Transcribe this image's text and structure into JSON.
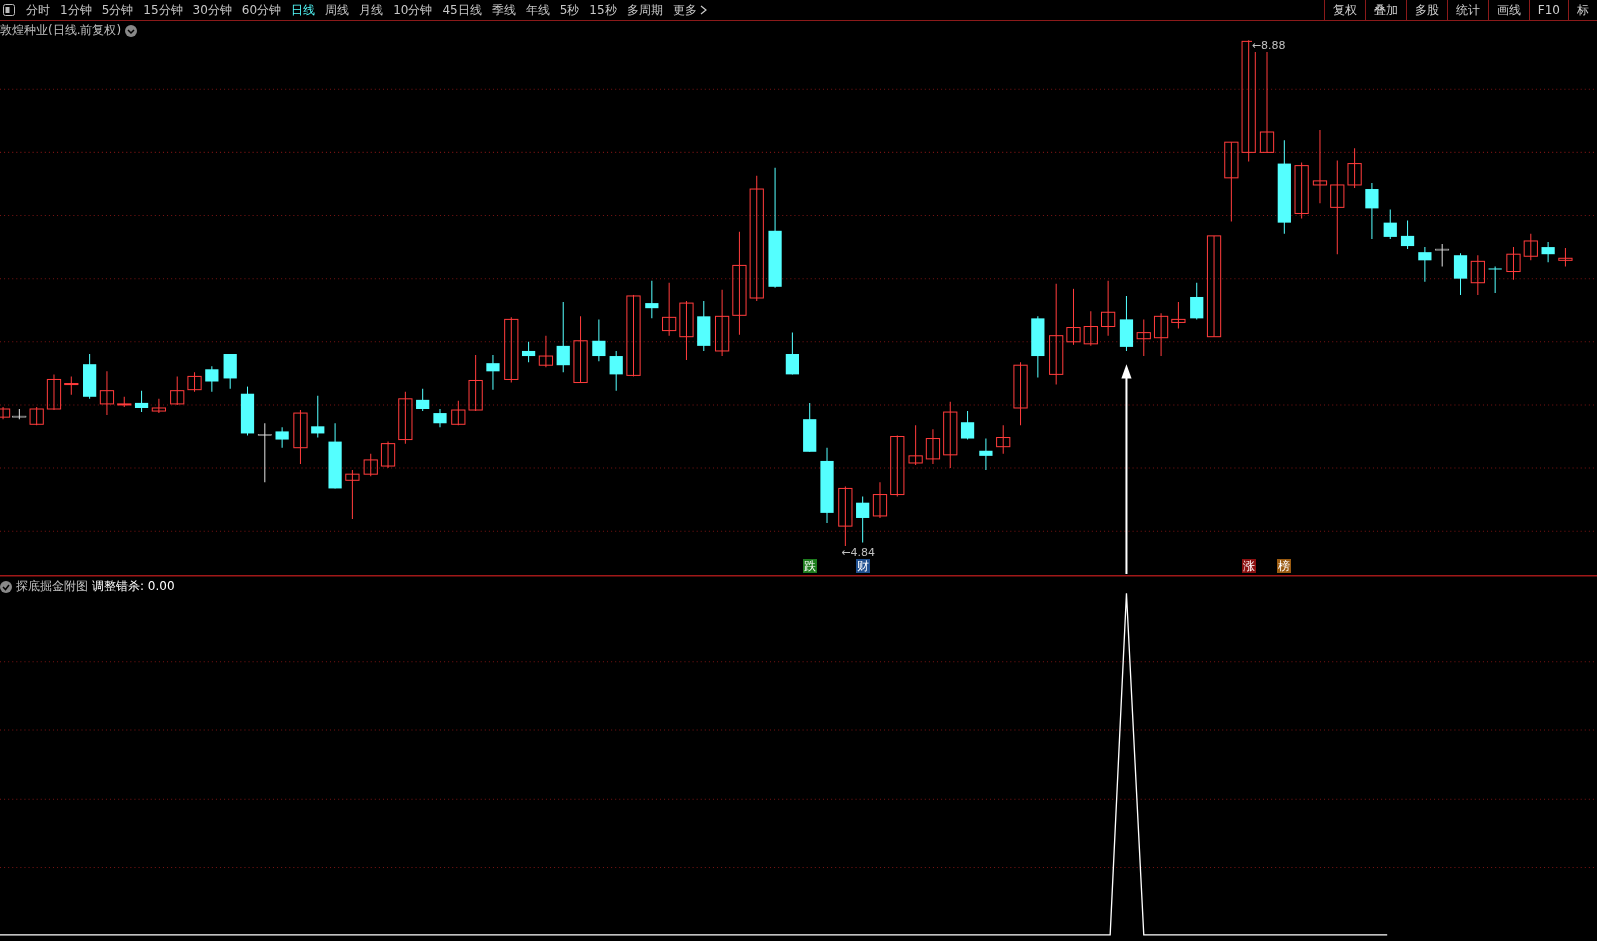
{
  "toolbar": {
    "periods": [
      {
        "label": "分时",
        "selected": false
      },
      {
        "label": "1分钟",
        "selected": false
      },
      {
        "label": "5分钟",
        "selected": false
      },
      {
        "label": "15分钟",
        "selected": false
      },
      {
        "label": "30分钟",
        "selected": false
      },
      {
        "label": "60分钟",
        "selected": false
      },
      {
        "label": "日线",
        "selected": true
      },
      {
        "label": "周线",
        "selected": false
      },
      {
        "label": "月线",
        "selected": false
      },
      {
        "label": "10分钟",
        "selected": false
      },
      {
        "label": "45日线",
        "selected": false
      },
      {
        "label": "季线",
        "selected": false
      },
      {
        "label": "年线",
        "selected": false
      },
      {
        "label": "5秒",
        "selected": false
      },
      {
        "label": "15秒",
        "selected": false
      },
      {
        "label": "多周期",
        "selected": false
      }
    ],
    "more": "更多",
    "tools": [
      "复权",
      "叠加",
      "多股",
      "统计",
      "画线",
      "F10",
      "标"
    ]
  },
  "main_chart": {
    "title": "敦煌种业(日线.前复权)",
    "price_labels": [
      "←8.88",
      "←4.84"
    ],
    "markers": [
      {
        "label": "跌",
        "color": "#1e7d1e"
      },
      {
        "label": "财",
        "color": "#1f4f8f"
      },
      {
        "label": "涨",
        "color": "#8b1010"
      },
      {
        "label": "榜",
        "color": "#9a5a10"
      }
    ]
  },
  "sub_chart": {
    "title": "探底掘金附图",
    "indicator": "调整错杀: 0.00"
  }
}
